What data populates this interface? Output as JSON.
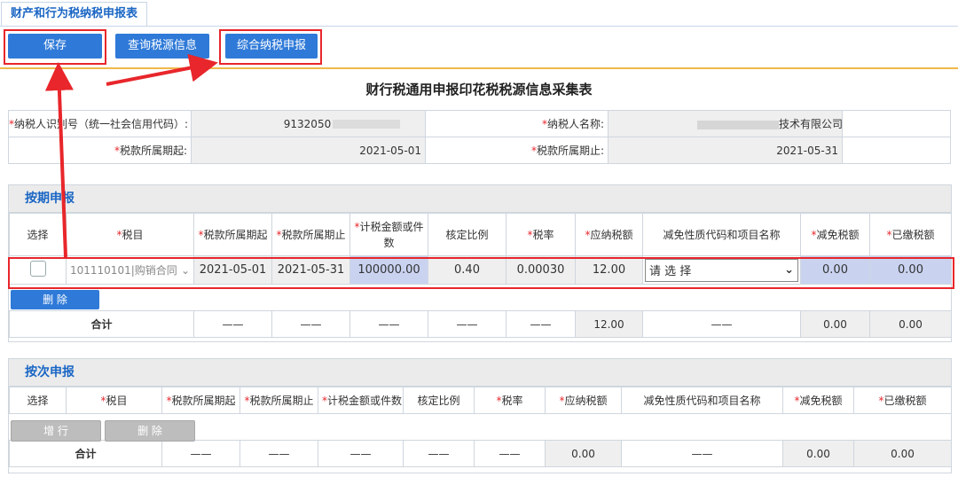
{
  "tab": {
    "label": "财产和行为税纳税申报表"
  },
  "toolbar": {
    "save": "保存",
    "query": "查询税源信息",
    "combined": "综合纳税申报"
  },
  "form_title": "财行税通用申报印花税税源信息采集表",
  "info": {
    "taxpayer_id_label": "纳税人识别号（统一社会信用代码）:",
    "taxpayer_id_value": "9132050",
    "taxpayer_name_label": "纳税人名称:",
    "taxpayer_name_suffix": "技术有限公司",
    "period_start_label": "税款所属期起:",
    "period_start_value": "2021-05-01",
    "period_end_label": "税款所属期止:",
    "period_end_value": "2021-05-31"
  },
  "periodic": {
    "title": "按期申报",
    "headers": [
      "选择",
      "税目",
      "税款所属期起",
      "税款所属期止",
      "计税金额或件数",
      "核定比例",
      "税率",
      "应纳税额",
      "减免性质代码和项目名称",
      "减免税额",
      "已缴税额"
    ],
    "row": {
      "tax_item": "101110101|购销合同",
      "start": "2021-05-01",
      "end": "2021-05-31",
      "amount": "100000.00",
      "ratio": "0.40",
      "rate": "0.00030",
      "payable": "12.00",
      "relief_select": "请 选 择",
      "relief": "0.00",
      "paid": "0.00"
    },
    "delete_label": "删 除",
    "total": {
      "label": "合计",
      "dash": "——",
      "payable": "12.00",
      "relief": "0.00",
      "paid": "0.00"
    }
  },
  "per_time": {
    "title": "按次申报",
    "headers": [
      "选择",
      "税目",
      "税款所属期起",
      "税款所属期止",
      "计税金额或件数",
      "核定比例",
      "税率",
      "应纳税额",
      "减免性质代码和项目名称",
      "减免税额",
      "已缴税额"
    ],
    "add_label": "增 行",
    "delete_label": "删 除",
    "total": {
      "label": "合计",
      "dash": "——",
      "payable": "0.00",
      "relief": "0.00",
      "paid": "0.00"
    }
  },
  "colors": {
    "accent": "#2f7ad8",
    "highlight": "#e8262b",
    "required": "#e8262b"
  }
}
